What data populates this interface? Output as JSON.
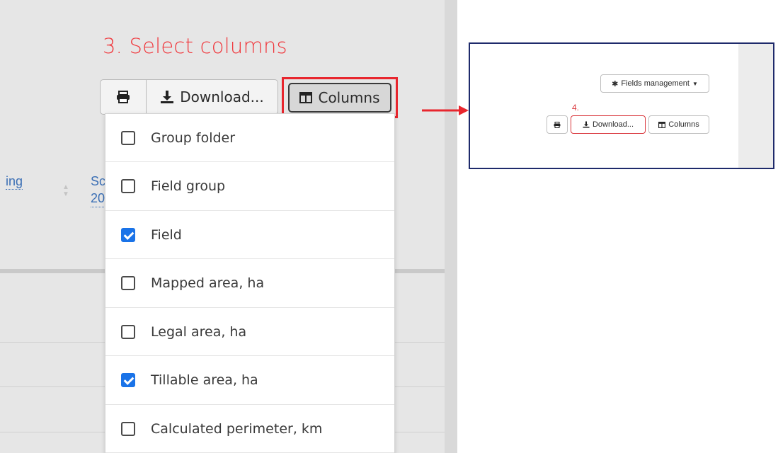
{
  "step3_title": "3. Select columns",
  "toolbar": {
    "download_label": "Download...",
    "columns_label": "Columns"
  },
  "background": {
    "partial_header_1": "ing",
    "partial_header_2_line1": "Sc",
    "partial_header_2_line2": "20"
  },
  "columns_menu": {
    "items": [
      {
        "label": "Group folder",
        "checked": false
      },
      {
        "label": "Field group",
        "checked": false
      },
      {
        "label": "Field",
        "checked": true
      },
      {
        "label": "Mapped area, ha",
        "checked": false
      },
      {
        "label": "Legal area, ha",
        "checked": false
      },
      {
        "label": "Tillable area, ha",
        "checked": true
      },
      {
        "label": "Calculated perimeter, km",
        "checked": false
      }
    ]
  },
  "inset": {
    "fields_management_label": "Fields management",
    "step4_label": "4.",
    "download_label": "Download...",
    "columns_label": "Columns"
  },
  "colors": {
    "highlight_red": "#e8262e",
    "checkbox_blue": "#1a73e8",
    "inset_border": "#1e2a6b"
  },
  "icons": {
    "print": "print-icon",
    "download": "download-icon",
    "columns": "columns-icon",
    "gear": "gear-icon",
    "caret": "caret-down-icon",
    "arrow": "arrow-right-icon"
  }
}
